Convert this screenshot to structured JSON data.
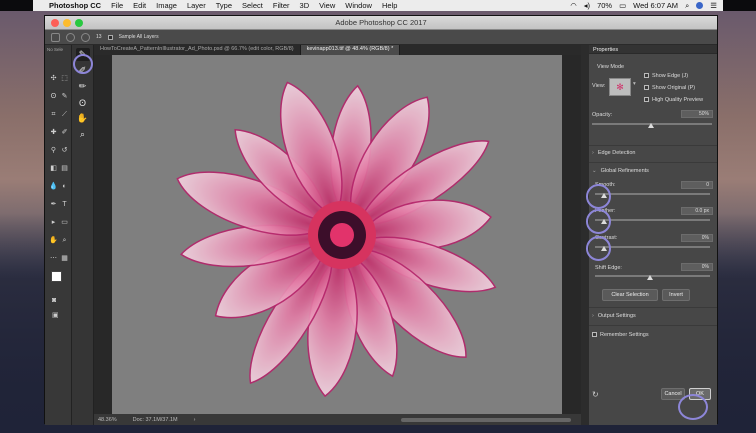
{
  "menubar": {
    "app": "Photoshop CC",
    "items": [
      "File",
      "Edit",
      "Image",
      "Layer",
      "Type",
      "Select",
      "Filter",
      "3D",
      "View",
      "Window",
      "Help"
    ],
    "battery": "70%",
    "clock": "Wed 6:07 AM"
  },
  "window": {
    "title": "Adobe Photoshop CC 2017"
  },
  "options_bar": {
    "size": "13",
    "sample_all_layers": "Sample All Layers"
  },
  "left_sidebar": {
    "tools_label": "No Sele"
  },
  "tabs": [
    {
      "label": "HowToCreateA_PatternInIllustrator_Ad_Photo.psd @ 66.7% (edit color, RGB/8)",
      "active": false
    },
    {
      "label": "kevinapp013.tif @ 48.4% (RGB/8) *",
      "active": true
    }
  ],
  "status": {
    "zoom": "48.36%",
    "doc": "Doc: 37.1M/37.1M"
  },
  "properties": {
    "title": "Properties",
    "view_mode": {
      "label": "View Mode",
      "view_label": "View:",
      "show_edge": "Show Edge (J)",
      "show_original": "Show Original (P)",
      "high_quality": "High Quality Preview"
    },
    "opacity": {
      "label": "Opacity:",
      "value": "50%"
    },
    "edge_detection": "Edge Detection",
    "global_refinements": {
      "label": "Global Refinements",
      "smooth": {
        "label": "Smooth:",
        "value": "0"
      },
      "feather": {
        "label": "Feather:",
        "value": "0.0 px"
      },
      "contrast": {
        "label": "Contrast:",
        "value": "0%"
      },
      "shift_edge": {
        "label": "Shift Edge:",
        "value": "0%"
      }
    },
    "clear_selection": "Clear Selection",
    "invert": "Invert",
    "output_settings": "Output Settings",
    "remember_settings": "Remember Settings",
    "cancel": "Cancel",
    "ok": "OK"
  },
  "colors": {
    "accent_ring": "#8d86d8",
    "foreground": "#ffffff",
    "background": "#cf2130"
  }
}
